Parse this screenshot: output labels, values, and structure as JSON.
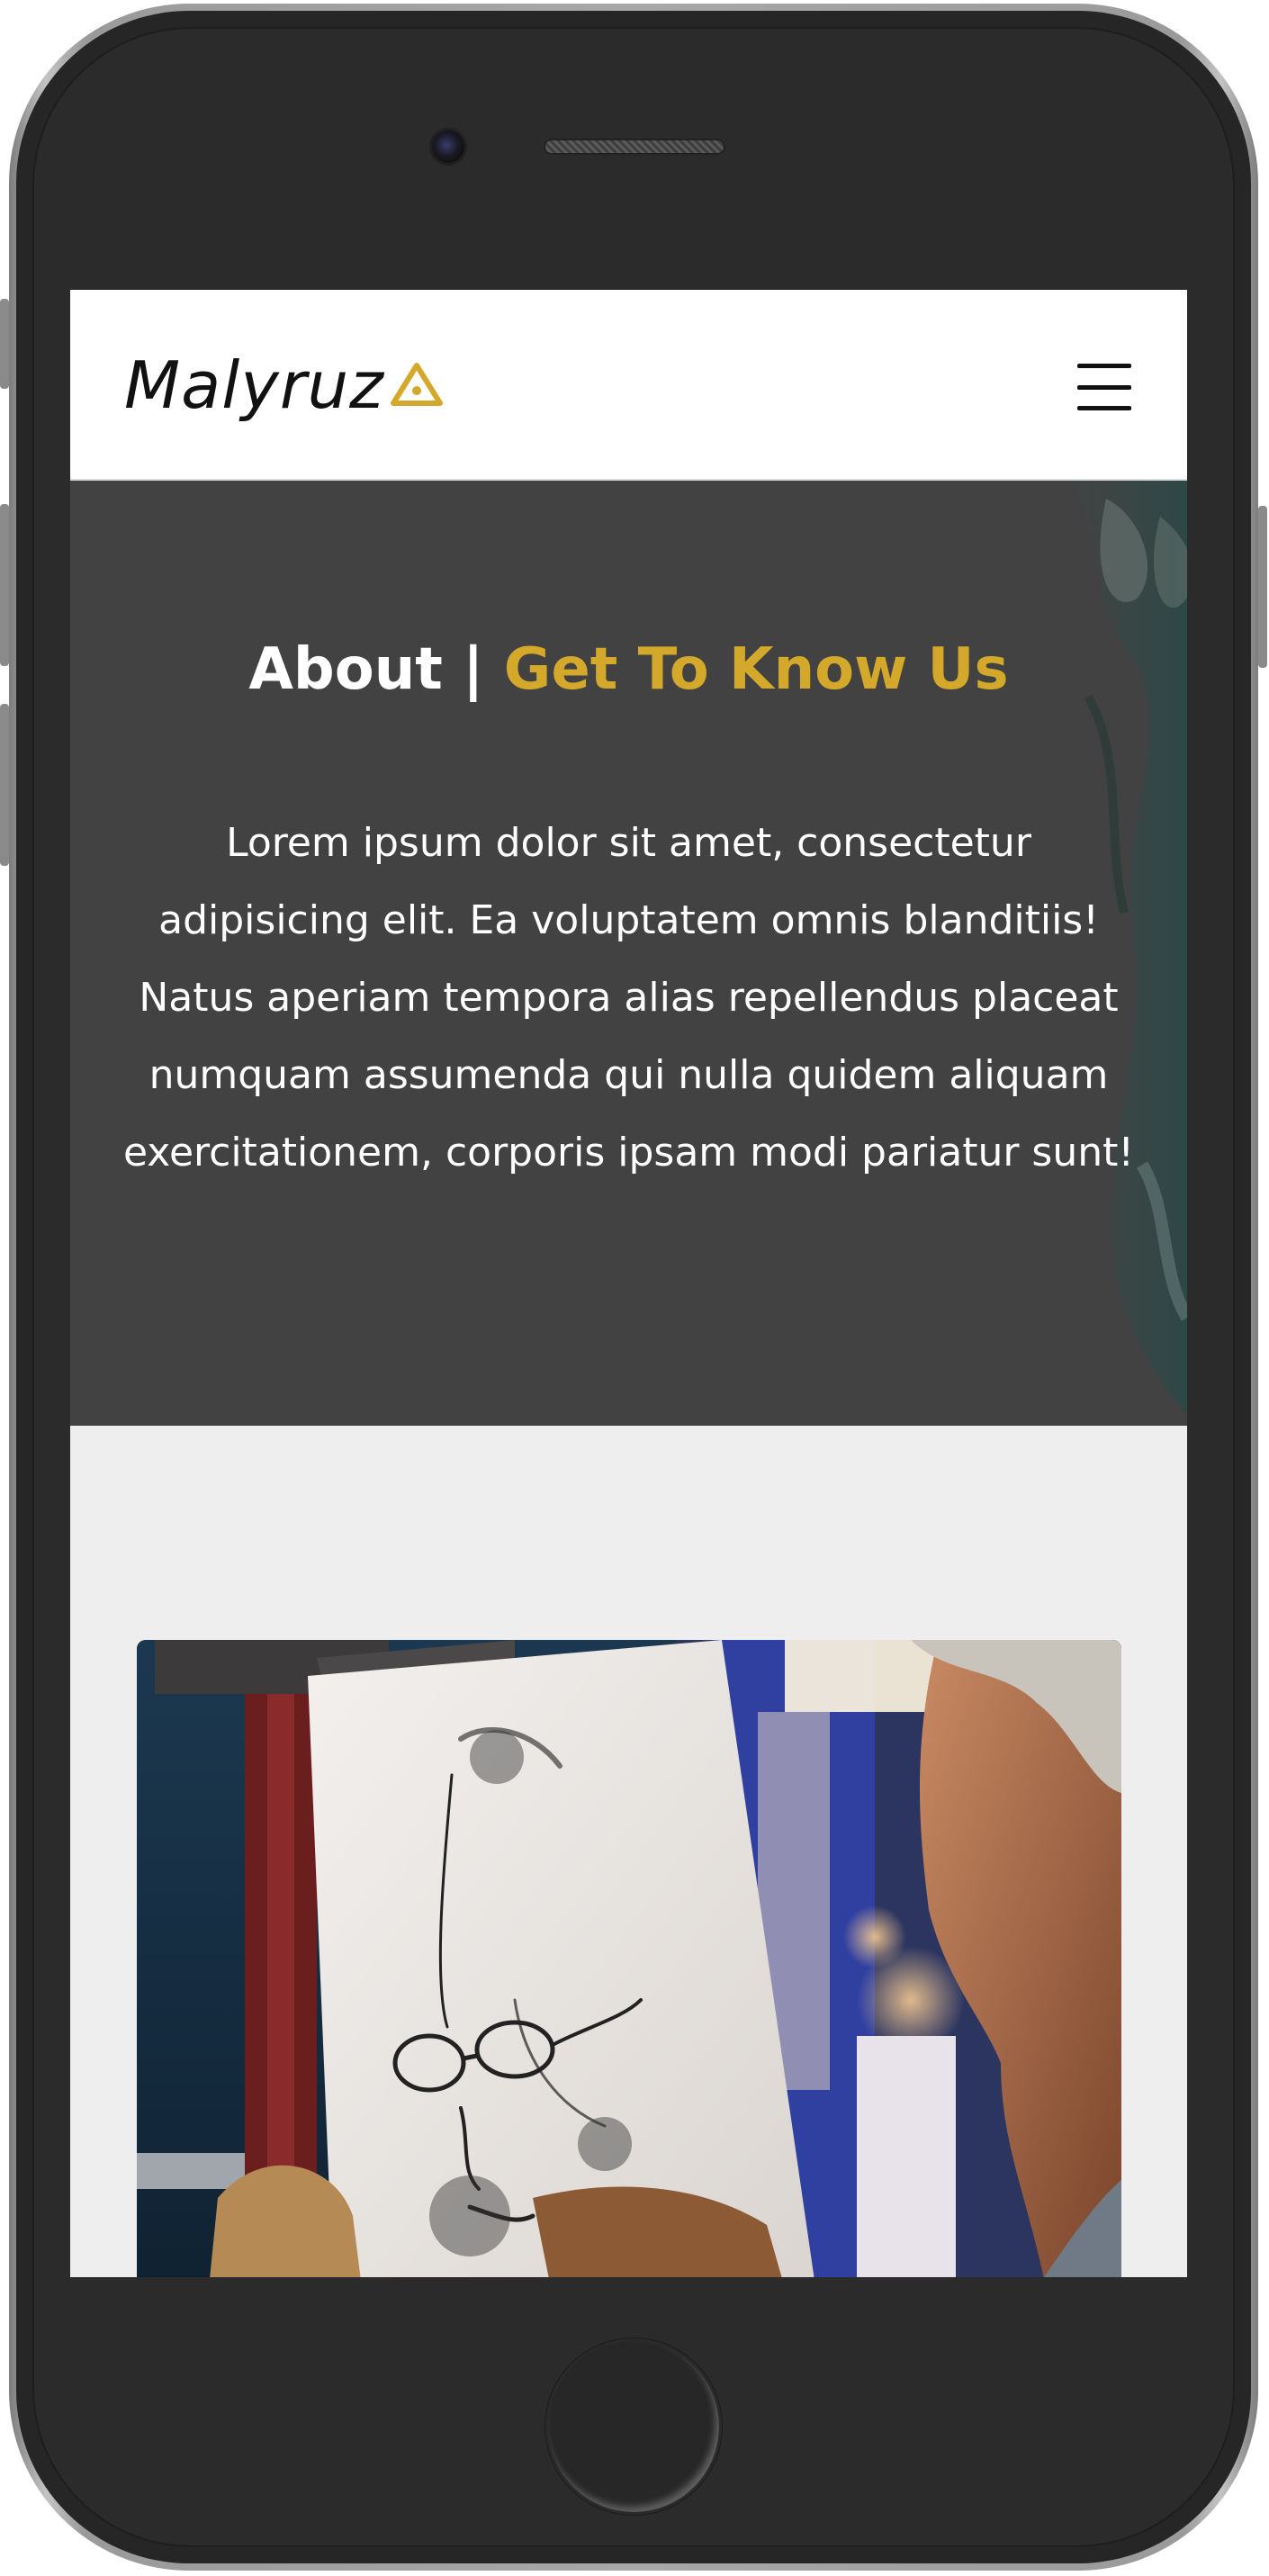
{
  "navbar": {
    "logo_text": "Malyruz",
    "logo_mark_icon": "triangle-logo-icon",
    "menu_icon": "hamburger-menu-icon"
  },
  "hero": {
    "title_main": "About",
    "title_separator": " | ",
    "title_accent": "Get To Know Us",
    "body": "Lorem ipsum dolor sit amet, consectetur adipisicing elit. Ea voluptatem omnis blanditiis! Natus aperiam tempora alias repellendus placeat numquam assumenda qui nulla quidem aliquam exercitationem, corporis ipsam modi pariatur sunt!"
  },
  "colors": {
    "accent": "#d4a82a",
    "hero_background": "#424242",
    "section_background": "#eeeeee"
  },
  "image": {
    "subject": "street-artist-sketching-portrait"
  }
}
